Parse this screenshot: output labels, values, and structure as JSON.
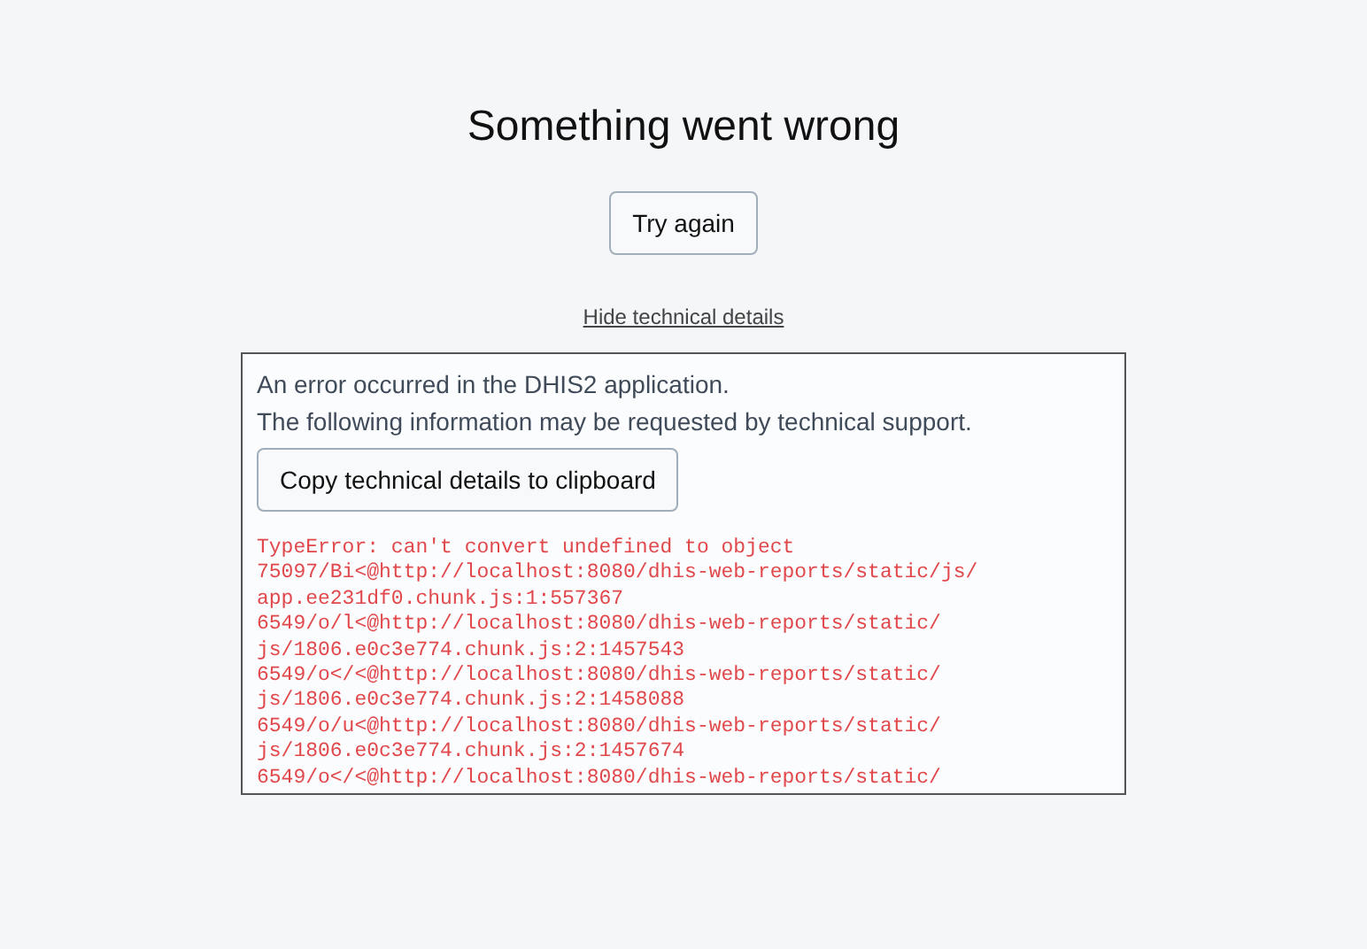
{
  "title": "Something went wrong",
  "retry_button": "Try again",
  "details_link": "Hide technical details",
  "details": {
    "message_lines": [
      "An error occurred in the DHIS2 application.",
      "The following information may be requested by technical support."
    ],
    "copy_button": "Copy technical details to clipboard",
    "trace_lines": [
      "TypeError: can't convert undefined to object",
      "75097/Bi<@http://localhost:8080/dhis-web-reports/static/js/",
      "app.ee231df0.chunk.js:1:557367",
      "6549/o/l<@http://localhost:8080/dhis-web-reports/static/",
      "js/1806.e0c3e774.chunk.js:2:1457543",
      "6549/o</<@http://localhost:8080/dhis-web-reports/static/",
      "js/1806.e0c3e774.chunk.js:2:1458088",
      "6549/o/u<@http://localhost:8080/dhis-web-reports/static/",
      "js/1806.e0c3e774.chunk.js:2:1457674",
      "6549/o</<@http://localhost:8080/dhis-web-reports/static/"
    ]
  }
}
